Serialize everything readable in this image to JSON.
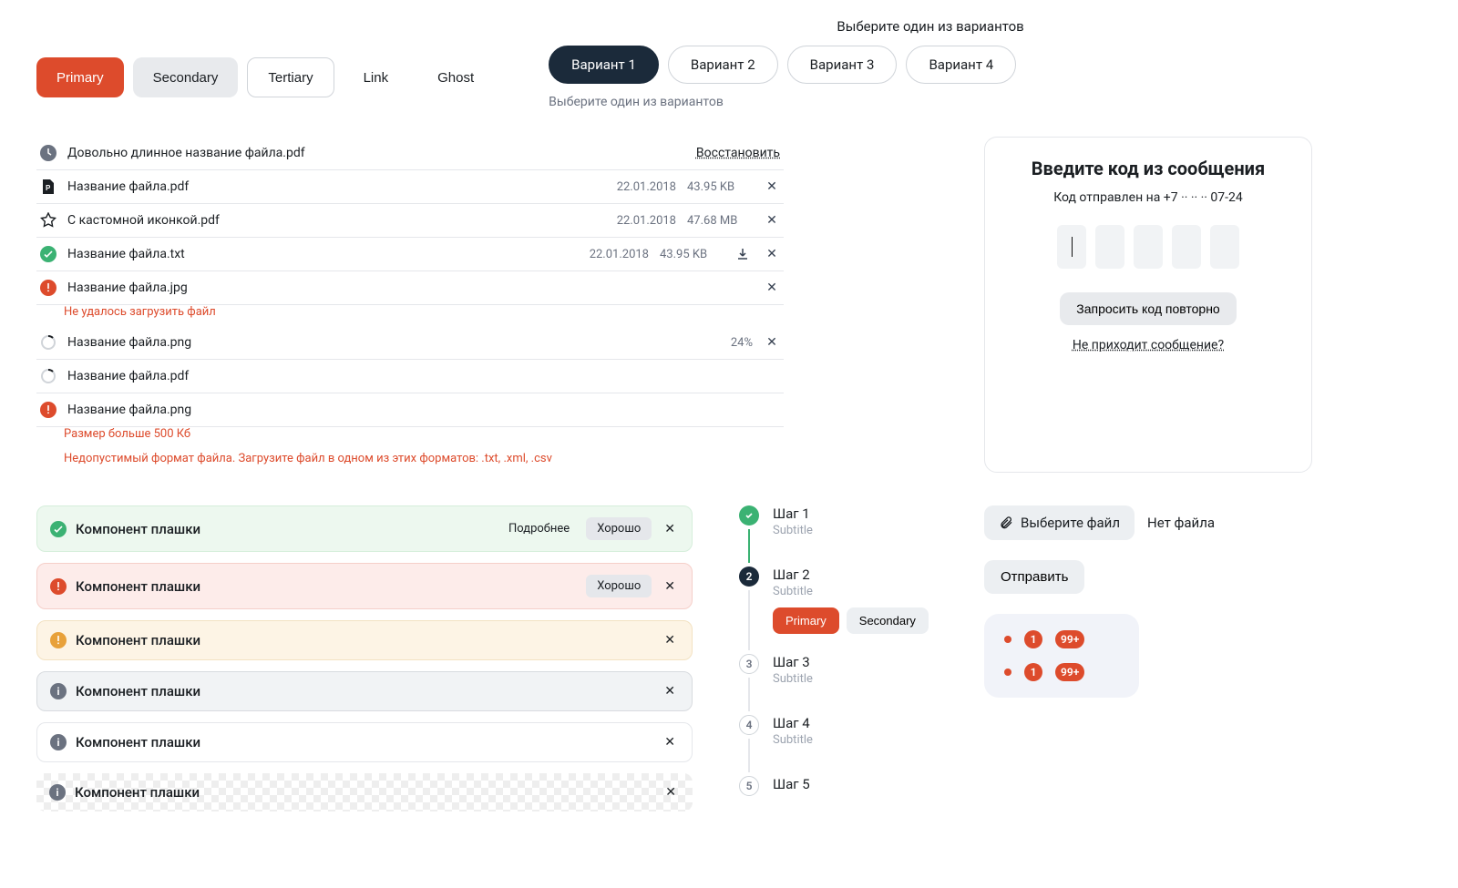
{
  "top_buttons": {
    "primary": "Primary",
    "secondary": "Secondary",
    "tertiary": "Tertiary",
    "link": "Link",
    "ghost": "Ghost"
  },
  "chooser": {
    "label": "Выберите один из вариантов",
    "caption": "Выберите один из вариантов",
    "items": [
      "Вариант 1",
      "Вариант 2",
      "Вариант 3",
      "Вариант 4"
    ]
  },
  "files": {
    "restore": "Восстановить",
    "items": [
      {
        "icon": "clock",
        "name": "Довольно длинное название файла.pdf",
        "restore": true
      },
      {
        "icon": "file-p",
        "name": "Название файла.pdf",
        "date": "22.01.2018",
        "size": "43.95 KB",
        "close": true
      },
      {
        "icon": "star",
        "name": "С кастомной иконкой.pdf",
        "date": "22.01.2018",
        "size": "47.68 MB",
        "close": true
      },
      {
        "icon": "check",
        "name": "Название файла.txt",
        "date": "22.01.2018",
        "size": "43.95 KB",
        "download": true,
        "close": true
      },
      {
        "icon": "warn",
        "name": "Название файла.jpg",
        "close": true,
        "errors": [
          "Не удалось загрузить файл"
        ]
      },
      {
        "icon": "spin",
        "name": "Название файла.png",
        "progress": "24%",
        "close": true
      },
      {
        "icon": "spin",
        "name": "Название файла.pdf"
      },
      {
        "icon": "warn",
        "name": "Название файла.png",
        "errors": [
          "Размер больше 500 Кб",
          "Недопустимый формат файла. Загрузите файл в одном из этих форматов: .txt, .xml, .csv"
        ]
      }
    ]
  },
  "code": {
    "title": "Введите код из сообщения",
    "sent_to": "Код отправлен на +7 ·· ·· ·· 07-24",
    "resend": "Запросить код повторно",
    "help": "Не приходит сообщение?"
  },
  "alerts": {
    "label": "Компонент плашки",
    "more": "Подробнее",
    "ok": "Хорошо"
  },
  "steps": {
    "items": [
      {
        "title": "Шаг 1",
        "sub": "Subtitle"
      },
      {
        "title": "Шаг 2",
        "sub": "Subtitle",
        "primary": "Primary",
        "secondary": "Secondary"
      },
      {
        "title": "Шаг 3",
        "sub": "Subtitle"
      },
      {
        "title": "Шаг 4",
        "sub": "Subtitle"
      },
      {
        "title": "Шаг 5"
      }
    ]
  },
  "upload": {
    "btn": "Выберите файл",
    "caption": "Нет файла",
    "send": "Отправить"
  },
  "badges": {
    "n1": "1",
    "n2": "99+",
    "n3": "1",
    "n4": "99+"
  }
}
